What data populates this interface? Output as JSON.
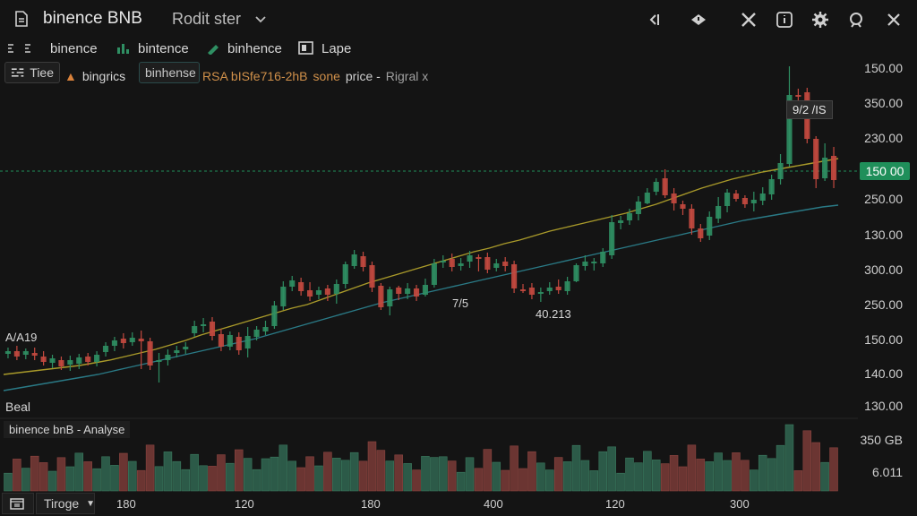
{
  "header": {
    "title": "binence BNB",
    "subtitle": "Rodit ster"
  },
  "tabs": [
    {
      "label": "binence"
    },
    {
      "label": "bintence"
    },
    {
      "label": "binhence"
    },
    {
      "label": "Lape"
    }
  ],
  "toolbar2": {
    "tiee": "Tiee",
    "bingrics": "bingrics",
    "binhense": "binhense",
    "info_text": "RSA bISfe716-2hB",
    "info_zone": "sone",
    "info_price": "price -",
    "info_signal": "Rigral x"
  },
  "price_axis": [
    "150.00",
    "350.00",
    "230.00",
    "250.00",
    "130.00",
    "300.00",
    "250.00",
    "150.00",
    "140.00",
    "130.00"
  ],
  "price_tag": "150 00",
  "annotations": {
    "left": "A/A19",
    "mid1": "7/5",
    "mid2": "40.213",
    "top_box": "9/2 /IS",
    "beat": "Beal"
  },
  "volume": {
    "title": "binence bnB - Analyse",
    "axis": [
      "350 GB",
      "6.011"
    ]
  },
  "bottom": {
    "tiroge": "Tiroge",
    "x_ticks": [
      "180",
      "120",
      "180",
      "400",
      "120",
      "300"
    ]
  },
  "colors": {
    "up": "#2f8f63",
    "down": "#c4493f",
    "ma_yellow": "#a99a2a",
    "ma_teal": "#2a7a86",
    "accent": "#1f8f5a"
  },
  "chart_data": {
    "type": "candlestick",
    "series": [
      {
        "name": "candles",
        "values": [
          [
            395,
            392,
            388,
            400
          ],
          [
            392,
            398,
            386,
            402
          ],
          [
            396,
            392,
            389,
            401
          ],
          [
            394,
            397,
            388,
            402
          ],
          [
            398,
            404,
            392,
            408
          ],
          [
            405,
            400,
            396,
            411
          ],
          [
            402,
            409,
            398,
            413
          ],
          [
            407,
            402,
            397,
            414
          ],
          [
            406,
            399,
            395,
            412
          ],
          [
            398,
            404,
            394,
            408
          ],
          [
            404,
            396,
            392,
            409
          ],
          [
            393,
            386,
            382,
            398
          ],
          [
            386,
            380,
            376,
            392
          ],
          [
            378,
            383,
            372,
            389
          ],
          [
            382,
            377,
            371,
            386
          ],
          [
            378,
            381,
            369,
            412
          ],
          [
            381,
            408,
            377,
            413
          ],
          [
            404,
            402,
            394,
            427
          ],
          [
            402,
            396,
            390,
            408
          ],
          [
            394,
            391,
            386,
            399
          ],
          [
            390,
            387,
            382,
            395
          ],
          [
            372,
            364,
            358,
            376
          ],
          [
            364,
            362,
            355,
            371
          ],
          [
            359,
            375,
            354,
            380
          ],
          [
            373,
            387,
            367,
            392
          ],
          [
            387,
            374,
            370,
            391
          ],
          [
            376,
            391,
            371,
            396
          ],
          [
            389,
            375,
            365,
            399
          ],
          [
            376,
            368,
            364,
            380
          ],
          [
            370,
            365,
            358,
            374
          ],
          [
            364,
            341,
            336,
            367
          ],
          [
            342,
            320,
            314,
            346
          ],
          [
            320,
            313,
            308,
            325
          ],
          [
            315,
            325,
            310,
            330
          ],
          [
            324,
            331,
            315,
            336
          ],
          [
            329,
            324,
            320,
            334
          ],
          [
            322,
            329,
            318,
            336
          ],
          [
            328,
            317,
            312,
            339
          ],
          [
            317,
            295,
            292,
            322
          ],
          [
            297,
            284,
            279,
            300
          ],
          [
            286,
            298,
            281,
            303
          ],
          [
            296,
            321,
            292,
            326
          ],
          [
            319,
            343,
            316,
            346
          ],
          [
            342,
            323,
            320,
            352
          ],
          [
            321,
            328,
            319,
            335
          ],
          [
            328,
            322,
            316,
            334
          ],
          [
            322,
            331,
            318,
            336
          ],
          [
            329,
            318,
            311,
            331
          ],
          [
            318,
            294,
            289,
            321
          ],
          [
            293,
            291,
            285,
            299
          ],
          [
            289,
            298,
            283,
            303
          ],
          [
            297,
            294,
            288,
            302
          ],
          [
            292,
            285,
            280,
            299
          ],
          [
            287,
            289,
            284,
            303
          ],
          [
            287,
            301,
            282,
            305
          ],
          [
            299,
            294,
            289,
            303
          ],
          [
            292,
            297,
            287,
            303
          ],
          [
            295,
            322,
            291,
            327
          ],
          [
            323,
            323,
            317,
            327
          ],
          [
            321,
            329,
            316,
            334
          ],
          [
            328,
            326,
            321,
            337
          ],
          [
            325,
            321,
            315,
            329
          ],
          [
            320,
            324,
            312,
            328
          ],
          [
            325,
            314,
            309,
            329
          ],
          [
            314,
            296,
            294,
            315
          ],
          [
            297,
            292,
            285,
            302
          ],
          [
            293,
            292,
            288,
            302
          ],
          [
            294,
            281,
            277,
            298
          ],
          [
            285,
            248,
            240,
            289
          ],
          [
            249,
            246,
            241,
            256
          ],
          [
            246,
            238,
            233,
            251
          ],
          [
            239,
            225,
            219,
            246
          ],
          [
            227,
            215,
            210,
            228
          ],
          [
            214,
            203,
            199,
            218
          ],
          [
            199,
            218,
            189,
            221
          ],
          [
            216,
            227,
            210,
            235
          ],
          [
            228,
            233,
            224,
            240
          ],
          [
            233,
            255,
            228,
            262
          ],
          [
            255,
            266,
            250,
            270
          ],
          [
            263,
            242,
            236,
            268
          ],
          [
            244,
            230,
            220,
            249
          ],
          [
            230,
            215,
            211,
            237
          ],
          [
            216,
            222,
            212,
            225
          ],
          [
            221,
            228,
            218,
            232
          ],
          [
            227,
            223,
            214,
            236
          ],
          [
            224,
            216,
            209,
            229
          ],
          [
            217,
            200,
            195,
            223
          ],
          [
            200,
            182,
            172,
            206
          ],
          [
            183,
            106,
            74,
            186
          ],
          [
            106,
            107,
            99,
            112
          ],
          [
            103,
            155,
            98,
            160
          ],
          [
            155,
            200,
            152,
            210
          ],
          [
            199,
            176,
            160,
            202
          ],
          [
            174,
            201,
            164,
            210
          ]
        ]
      }
    ],
    "ma_yellow": [
      418,
      416,
      414,
      412,
      410,
      408,
      405,
      402,
      398,
      394,
      390,
      385,
      380,
      374,
      369,
      364,
      359,
      354,
      349,
      344,
      340,
      334,
      328,
      322,
      316,
      311,
      306,
      301,
      296,
      291,
      286,
      281,
      277,
      272,
      268,
      263,
      258,
      254,
      250,
      246,
      242,
      238,
      233,
      228,
      222,
      216,
      210,
      205,
      200,
      196,
      192,
      189,
      186,
      183,
      180,
      177
    ],
    "ma_teal": [
      436,
      433,
      430,
      427,
      424,
      421,
      418,
      414,
      410,
      406,
      402,
      398,
      394,
      390,
      386,
      382,
      378,
      373,
      368,
      363,
      358,
      353,
      348,
      343,
      338,
      334,
      330,
      326,
      322,
      318,
      314,
      310,
      306,
      302,
      298,
      294,
      290,
      286,
      282,
      278,
      274,
      270,
      266,
      262,
      258,
      254,
      250,
      246,
      243,
      240,
      237,
      234,
      231,
      229
    ]
  }
}
